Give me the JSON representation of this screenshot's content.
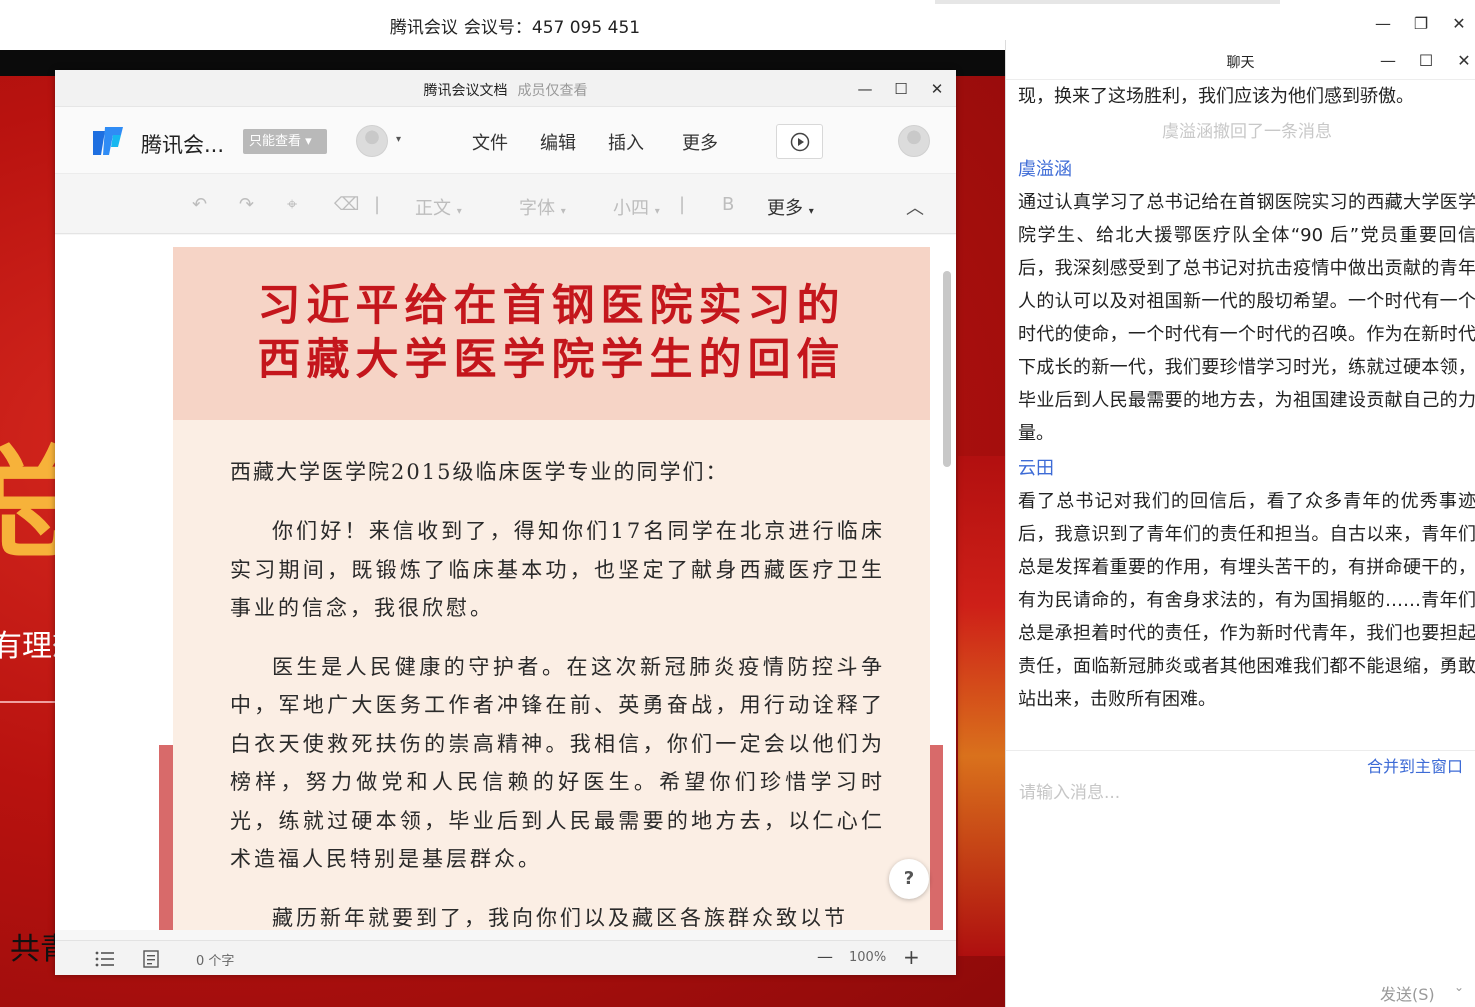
{
  "meeting": {
    "app_name": "腾讯会议",
    "meeting_id_label": "会议号：",
    "meeting_id": "457 095 451"
  },
  "window_controls": {
    "minimize": "—",
    "restore": "❐",
    "close": "✕",
    "maximize": "☐"
  },
  "shared_slide": {
    "big_char": "总",
    "text_line1": "有理想",
    "text_line2": "共青"
  },
  "doc": {
    "window_title": "腾讯会议文档",
    "window_subtitle": "成员仅查看",
    "name": "腾讯会...",
    "readonly_badge": "只能查看 ▾",
    "avatar_caret": "▾",
    "menu": [
      "文件",
      "编辑",
      "插入",
      "更多"
    ],
    "format": {
      "undo": "↶",
      "redo": "↷",
      "paint": "⌖",
      "eraser": "⌫",
      "separator": "|",
      "style": "正文",
      "font": "字体",
      "size": "小四",
      "bold": "B",
      "more": "更多",
      "dropdown_caret": "▾",
      "collapse": "︿"
    },
    "paper": {
      "title_line1": "习近平给在首钢医院实习的",
      "title_line2": "西藏大学医学院学生的回信",
      "salutation": "西藏大学医学院2015级临床医学专业的同学们：",
      "paragraphs": [
        "你们好！来信收到了，得知你们17名同学在北京进行临床实习期间，既锻炼了临床基本功，也坚定了献身西藏医疗卫生事业的信念，我很欣慰。",
        "医生是人民健康的守护者。在这次新冠肺炎疫情防控斗争中，军地广大医务工作者冲锋在前、英勇奋战，用行动诠释了白衣天使救死扶伤的崇高精神。我相信，你们一定会以他们为榜样，努力做党和人民信赖的好医生。希望你们珍惜学习时光，练就过硬本领，毕业后到人民最需要的地方去，以仁心仁术造福人民特别是基层群众。",
        "藏历新年就要到了，我向你们以及藏区各族群众致以节"
      ]
    },
    "help_label": "?",
    "status": {
      "word_count": "0 个字",
      "zoom": "100%",
      "zoom_out": "—",
      "zoom_in": "+"
    }
  },
  "chat": {
    "title": "聊天",
    "messages": [
      {
        "type": "text",
        "text": "现，换来了这场胜利，我们应该为他们感到骄傲。"
      },
      {
        "type": "system",
        "text": "虞溢涵撤回了一条消息"
      },
      {
        "type": "sender",
        "text": "虞溢涵"
      },
      {
        "type": "text",
        "text": "通过认真学习了总书记给在首钢医院实习的西藏大学医学院学生、给北大援鄂医疗队全体“90 后”党员重要回信后，我深刻感受到了总书记对抗击疫情中做出贡献的青年人的认可以及对祖国新一代的殷切希望。一个时代有一个时代的使命，一个时代有一个时代的召唤。作为在新时代下成长的新一代，我们要珍惜学习时光，练就过硬本领，毕业后到人民最需要的地方去，为祖国建设贡献自己的力量。"
      },
      {
        "type": "sender",
        "text": "云田"
      },
      {
        "type": "text",
        "text": "看了总书记对我们的回信后，看了众多青年的优秀事迹后，我意识到了青年们的责任和担当。自古以来，青年们总是发挥着重要的作用，有埋头苦干的，有拼命硬干的，有为民请命的，有舍身求法的，有为国捐躯的……青年们总是承担着时代的责任，作为新时代青年，我们也要担起责任，面临新冠肺炎或者其他困难我们都不能退缩，勇敢站出来，击败所有困难。"
      }
    ],
    "merge_link": "合并到主窗口",
    "input_placeholder": "请输入消息...",
    "send_label": "发送(S)",
    "send_caret": "⌄"
  }
}
